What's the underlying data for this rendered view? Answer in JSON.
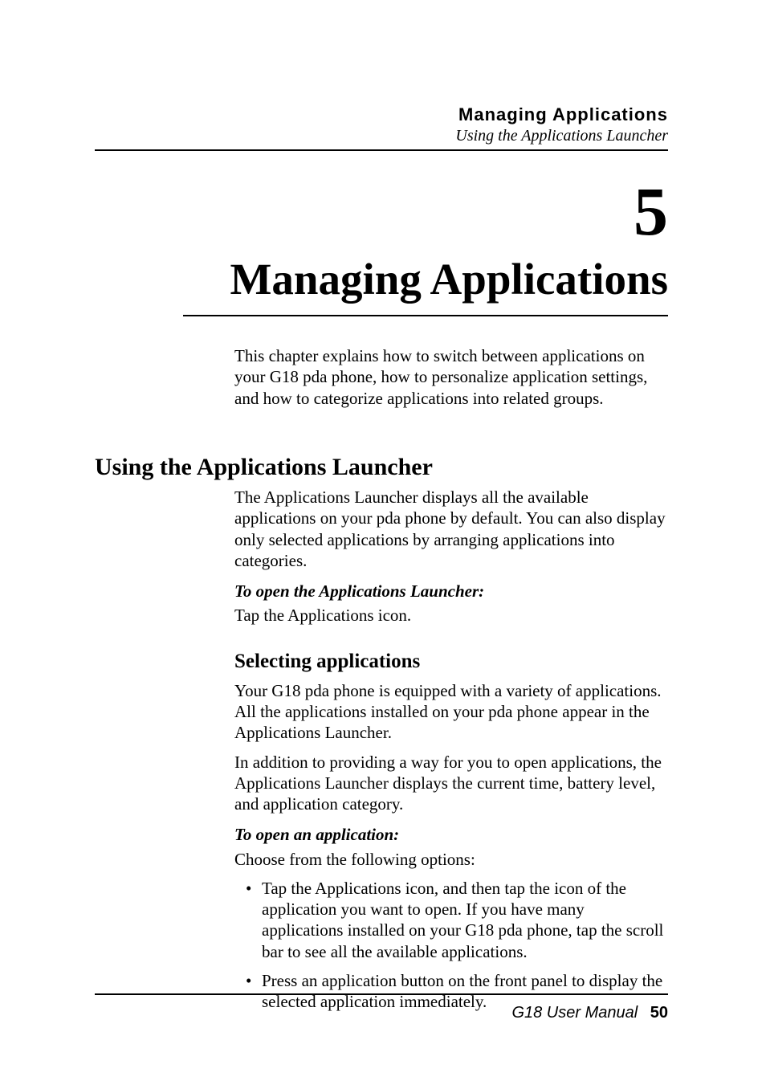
{
  "header": {
    "title": "Managing Applications",
    "subtitle": "Using the Applications Launcher"
  },
  "chapter": {
    "number": "5",
    "title": "Managing Applications",
    "intro": "This chapter explains how to switch between applications on your G18 pda phone, how to personalize application settings, and how to categorize applications into related groups."
  },
  "section": {
    "title": "Using the Applications Launcher",
    "intro": "The Applications Launcher displays all the available applications on your pda phone by default. You can also display only selected applications by arranging applications into categories.",
    "proc1_label": "To open the Applications Launcher:",
    "proc1_text": "Tap the Applications icon.",
    "sub": {
      "title": "Selecting applications",
      "p1": "Your G18 pda phone is equipped with a variety of applications. All the applications installed on your pda phone appear in the Applications Launcher.",
      "p2": "In addition to providing a way for you to open applications, the Applications Launcher displays the current time, battery level, and application category.",
      "proc_label": "To open an application:",
      "proc_text": "Choose from the following options:",
      "bullets": [
        "Tap the Applications icon, and then tap the icon of the application you want to open. If you have many applications installed on your G18 pda phone, tap the scroll bar to see all the available applications.",
        "Press an application button on the front panel to display the selected application immediately."
      ]
    }
  },
  "footer": {
    "manual": "G18 User Manual",
    "page": "50"
  }
}
